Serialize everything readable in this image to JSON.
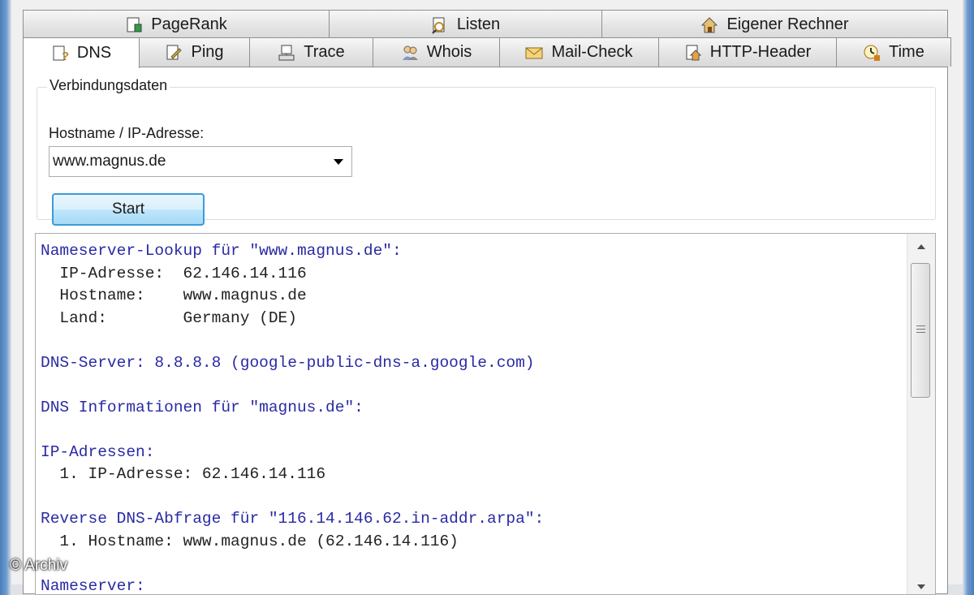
{
  "tabs_row1": [
    {
      "label": "PageRank",
      "icon": "pagerank-icon"
    },
    {
      "label": "Listen",
      "icon": "list-search-icon"
    },
    {
      "label": "Eigener Rechner",
      "icon": "home-computer-icon"
    }
  ],
  "tabs_row2": [
    {
      "label": "DNS",
      "icon": "dns-help-icon",
      "active": true
    },
    {
      "label": "Ping",
      "icon": "ping-icon"
    },
    {
      "label": "Trace",
      "icon": "trace-icon"
    },
    {
      "label": "Whois",
      "icon": "whois-users-icon"
    },
    {
      "label": "Mail-Check",
      "icon": "mail-icon"
    },
    {
      "label": "HTTP-Header",
      "icon": "http-house-icon"
    },
    {
      "label": "Time",
      "icon": "time-icon"
    }
  ],
  "connection": {
    "legend": "Verbindungsdaten",
    "host_label": "Hostname / IP-Adresse:",
    "host_value": "www.magnus.de",
    "start_label": "Start"
  },
  "output": {
    "lines": [
      {
        "text": "Nameserver-Lookup für \"www.magnus.de\":",
        "head": true
      },
      {
        "text": "  IP-Adresse:  62.146.14.116",
        "head": false
      },
      {
        "text": "  Hostname:    www.magnus.de",
        "head": false
      },
      {
        "text": "  Land:        Germany (DE)",
        "head": false
      },
      {
        "text": "",
        "head": false
      },
      {
        "text": "DNS-Server: 8.8.8.8 (google-public-dns-a.google.com)",
        "head": true
      },
      {
        "text": "",
        "head": false
      },
      {
        "text": "DNS Informationen für \"magnus.de\":",
        "head": true
      },
      {
        "text": "",
        "head": false
      },
      {
        "text": "IP-Adressen:",
        "head": true
      },
      {
        "text": "  1. IP-Adresse: 62.146.14.116",
        "head": false
      },
      {
        "text": "",
        "head": false
      },
      {
        "text": "Reverse DNS-Abfrage für \"116.14.146.62.in-addr.arpa\":",
        "head": true
      },
      {
        "text": "  1. Hostname: www.magnus.de (62.146.14.116)",
        "head": false
      },
      {
        "text": "",
        "head": false
      },
      {
        "text": "Nameserver:",
        "head": true
      }
    ]
  },
  "watermark": "© Archiv",
  "colors": {
    "heading_text": "#2a2aa5",
    "button_border": "#3c9bd8"
  }
}
